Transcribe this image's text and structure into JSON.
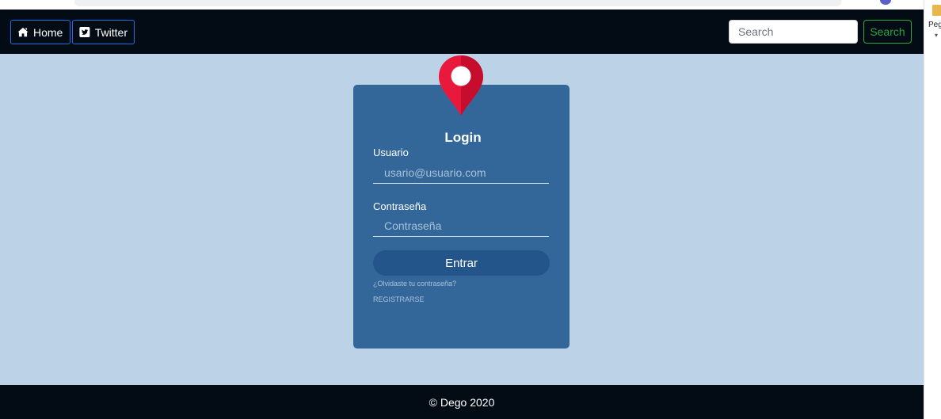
{
  "navbar": {
    "home_label": "Home",
    "twitter_label": "Twitter",
    "search_placeholder": "Search",
    "search_button": "Search"
  },
  "login": {
    "title": "Login",
    "user_label": "Usuario",
    "user_placeholder": "usario@usuario.com",
    "password_label": "Contraseña",
    "password_placeholder": "Contraseña",
    "submit_label": "Entrar",
    "forgot_link": "¿Olvidaste tu contraseña?",
    "register_link": "REGISTRARSE"
  },
  "footer": {
    "text": "© Dego 2020"
  },
  "side_panel": {
    "text": "Peg"
  },
  "colors": {
    "navbar_bg": "#030b14",
    "page_bg": "#bcd3e7",
    "card_bg": "#346799",
    "button_bg": "#23558b",
    "pin": "#e8193c",
    "nav_border": "#1f6fe0",
    "search_green": "#28a745"
  },
  "icons": {
    "home": "home-icon",
    "twitter": "twitter-square-icon",
    "pin": "map-pin-icon"
  }
}
